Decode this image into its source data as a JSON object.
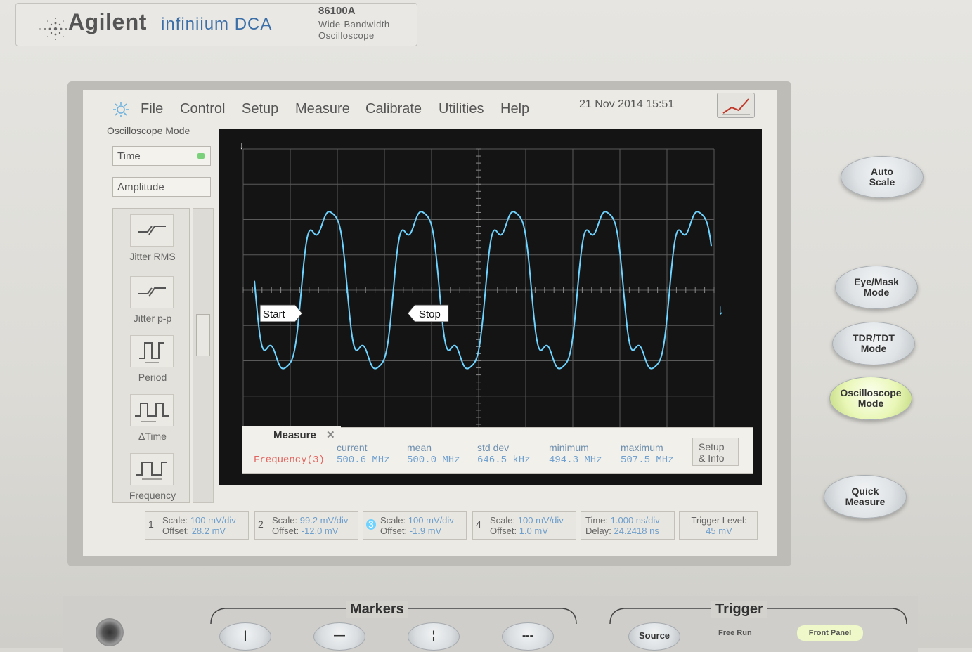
{
  "brand": {
    "name": "Agilent",
    "product": "infiniium DCA",
    "model": "86100A",
    "description_line1": "Wide-Bandwidth",
    "description_line2": "Oscilloscope"
  },
  "menu": [
    "File",
    "Control",
    "Setup",
    "Measure",
    "Calibrate",
    "Utilities",
    "Help"
  ],
  "datetime": "21 Nov 2014   15:51",
  "mode_label": "Oscilloscope Mode",
  "left_panel": {
    "time_field": "Time",
    "amplitude_field": "Amplitude",
    "measurements": [
      "Jitter RMS",
      "Jitter p-p",
      "Period",
      "ΔTime",
      "Frequency"
    ]
  },
  "display": {
    "start_marker": "Start",
    "stop_marker": "Stop",
    "waveform_color": "#6fd3ff"
  },
  "measure_strip": {
    "tab_label": "Measure",
    "measurement_name": "Frequency(3)",
    "columns": [
      {
        "header": "current",
        "value": "500.6 MHz"
      },
      {
        "header": "mean",
        "value": "500.0 MHz"
      },
      {
        "header": "std dev",
        "value": "646.5 kHz"
      },
      {
        "header": "minimum",
        "value": "494.3 MHz"
      },
      {
        "header": "maximum",
        "value": "507.5 MHz"
      }
    ],
    "setup_line1": "Setup",
    "setup_line2": "& Info"
  },
  "channels": [
    {
      "num": "1",
      "scale_label": "Scale:",
      "scale": "100 mV/div",
      "offset_label": "Offset:",
      "offset": "28.2 mV"
    },
    {
      "num": "2",
      "scale_label": "Scale:",
      "scale": "99.2 mV/div",
      "offset_label": "Offset:",
      "offset": "-12.0 mV"
    },
    {
      "num": "3",
      "scale_label": "Scale:",
      "scale": "100 mV/div",
      "offset_label": "Offset:",
      "offset": "-1.9 mV"
    },
    {
      "num": "4",
      "scale_label": "Scale:",
      "scale": "100 mV/div",
      "offset_label": "Offset:",
      "offset": "1.0 mV"
    }
  ],
  "timebase": {
    "time_label": "Time:",
    "time": "1.000 ns/div",
    "delay_label": "Delay:",
    "delay": "24.2418 ns"
  },
  "trigger_level": {
    "label": "Trigger Level:",
    "value": "45 mV"
  },
  "hardware_buttons": {
    "auto_scale": [
      "Auto",
      "Scale"
    ],
    "eye_mask": [
      "Eye/Mask",
      "Mode"
    ],
    "tdr_tdt": [
      "TDR/TDT",
      "Mode"
    ],
    "oscilloscope": [
      "Oscilloscope",
      "Mode"
    ],
    "quick_measure": [
      "Quick",
      "Measure"
    ]
  },
  "bottom": {
    "markers_title": "Markers",
    "trigger_title": "Trigger",
    "source_label": "Source",
    "free_run_label": "Free Run",
    "front_panel_label": "Front Panel",
    "marker_buttons": [
      "|",
      "—",
      "¦",
      "---"
    ]
  }
}
